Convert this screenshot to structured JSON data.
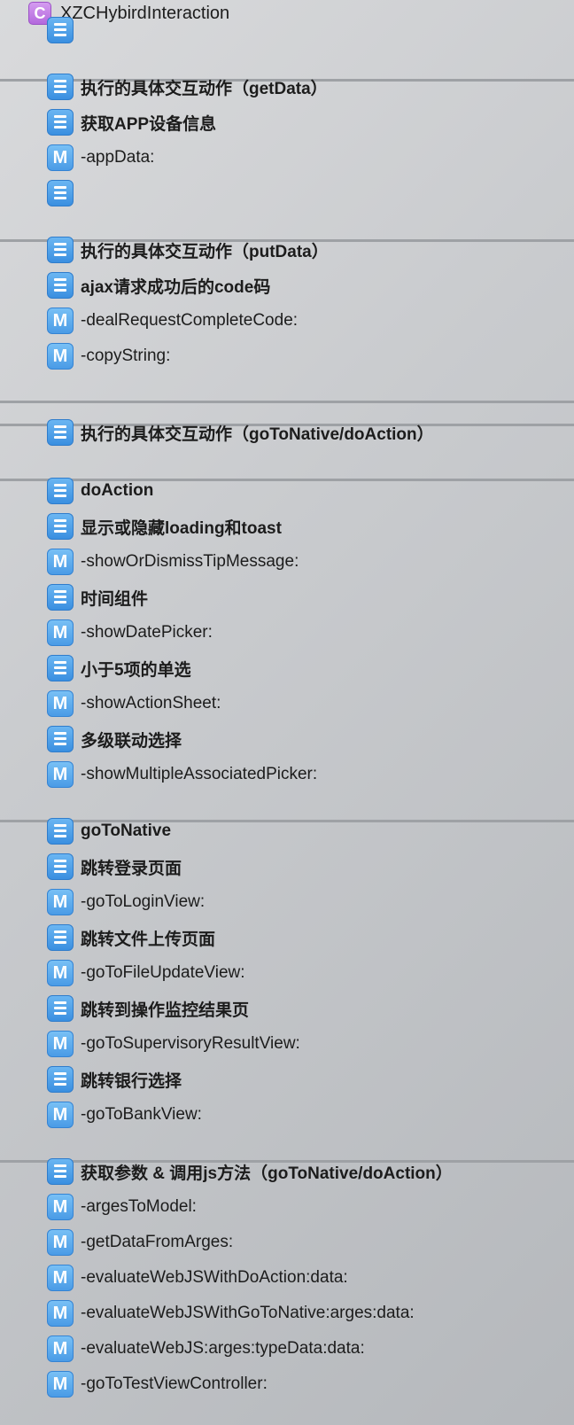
{
  "header": {
    "icon": "class-icon",
    "icon_letter": "C",
    "title": "XZCHybirdInteraction"
  },
  "method_icon_letter": "M",
  "rows": [
    {
      "kind": "mark",
      "label": "",
      "bold": true
    },
    {
      "kind": "mark",
      "label": "执行的具体交互动作（getData）",
      "bold": true
    },
    {
      "kind": "mark",
      "label": "获取APP设备信息",
      "bold": true
    },
    {
      "kind": "method",
      "label": "-appData:",
      "bold": false
    },
    {
      "kind": "mark",
      "label": "",
      "bold": true
    },
    {
      "kind": "mark",
      "label": "执行的具体交互动作（putData）",
      "bold": true
    },
    {
      "kind": "mark",
      "label": "ajax请求成功后的code码",
      "bold": true
    },
    {
      "kind": "method",
      "label": "-dealRequestCompleteCode:",
      "bold": false
    },
    {
      "kind": "method",
      "label": "-copyString:",
      "bold": false
    },
    {
      "kind": "mark",
      "label": "执行的具体交互动作（goToNative/doAction）",
      "bold": true
    },
    {
      "kind": "mark",
      "label": "doAction",
      "bold": true
    },
    {
      "kind": "mark",
      "label": "显示或隐藏loading和toast",
      "bold": true
    },
    {
      "kind": "method",
      "label": "-showOrDismissTipMessage:",
      "bold": false
    },
    {
      "kind": "mark",
      "label": "时间组件",
      "bold": true
    },
    {
      "kind": "method",
      "label": "-showDatePicker:",
      "bold": false
    },
    {
      "kind": "mark",
      "label": "小于5项的单选",
      "bold": true
    },
    {
      "kind": "method",
      "label": "-showActionSheet:",
      "bold": false
    },
    {
      "kind": "mark",
      "label": "多级联动选择",
      "bold": true
    },
    {
      "kind": "method",
      "label": "-showMultipleAssociatedPicker:",
      "bold": false
    },
    {
      "kind": "mark",
      "label": "goToNative",
      "bold": true
    },
    {
      "kind": "mark",
      "label": "跳转登录页面",
      "bold": true
    },
    {
      "kind": "method",
      "label": "-goToLoginView:",
      "bold": false
    },
    {
      "kind": "mark",
      "label": "跳转文件上传页面",
      "bold": true
    },
    {
      "kind": "method",
      "label": "-goToFileUpdateView:",
      "bold": false
    },
    {
      "kind": "mark",
      "label": "跳转到操作监控结果页",
      "bold": true
    },
    {
      "kind": "method",
      "label": "-goToSupervisoryResultView:",
      "bold": false
    },
    {
      "kind": "mark",
      "label": "跳转银行选择",
      "bold": true
    },
    {
      "kind": "method",
      "label": "-goToBankView:",
      "bold": false
    },
    {
      "kind": "mark",
      "label": "获取参数 & 调用js方法（goToNative/doAction）",
      "bold": true
    },
    {
      "kind": "method",
      "label": "-argesToModel:",
      "bold": false
    },
    {
      "kind": "method",
      "label": "-getDataFromArges:",
      "bold": false
    },
    {
      "kind": "method",
      "label": "-evaluateWebJSWithDoAction:data:",
      "bold": false
    },
    {
      "kind": "method",
      "label": "-evaluateWebJSWithGoToNative:arges:data:",
      "bold": false
    },
    {
      "kind": "method",
      "label": "-evaluateWebJS:arges:typeData:data:",
      "bold": false
    },
    {
      "kind": "method",
      "label": "-goToTestViewController:",
      "bold": false
    }
  ],
  "colors": {
    "mark_icon": "#4a9be6",
    "method_icon": "#5aa8ec",
    "class_icon": "#c07fe4",
    "separator": "#9ea1a5"
  }
}
